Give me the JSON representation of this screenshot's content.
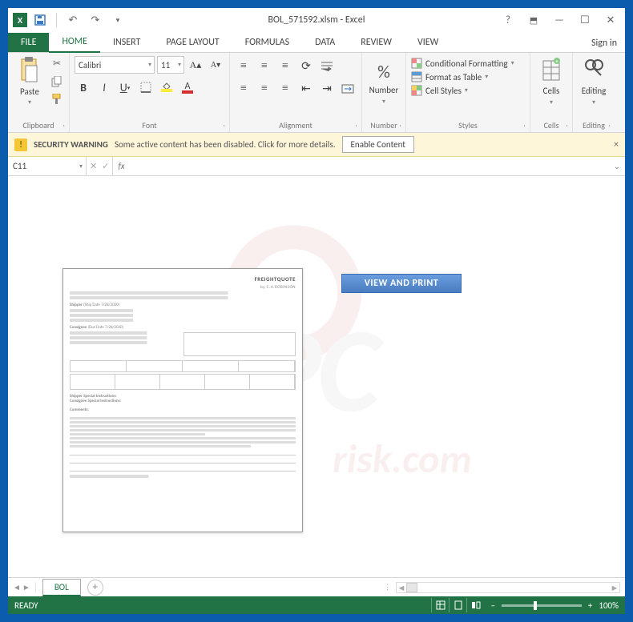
{
  "title": "BOL_571592.xlsm - Excel",
  "tabs": {
    "file": "FILE",
    "home": "HOME",
    "insert": "INSERT",
    "pagelayout": "PAGE LAYOUT",
    "formulas": "FORMULAS",
    "data": "DATA",
    "review": "REVIEW",
    "view": "VIEW"
  },
  "signin": "Sign in",
  "ribbon": {
    "clipboard": {
      "paste": "Paste",
      "label": "Clipboard"
    },
    "font": {
      "name": "Calibri",
      "size": "11",
      "label": "Font"
    },
    "alignment": {
      "label": "Alignment"
    },
    "number": {
      "big": "Number",
      "label": "Number",
      "pct": "%"
    },
    "styles": {
      "cond": "Conditional Formatting",
      "table": "Format as Table",
      "cell": "Cell Styles",
      "label": "Styles"
    },
    "cells": {
      "big": "Cells",
      "label": "Cells"
    },
    "editing": {
      "big": "Editing",
      "label": "Editing"
    }
  },
  "warning": {
    "title": "SECURITY WARNING",
    "text": "Some active content has been disabled. Click for more details.",
    "button": "Enable Content"
  },
  "fx": {
    "cell": "C11",
    "label": "fx"
  },
  "sheet": {
    "button": "VIEW AND PRINT",
    "doc_brand": "FREIGHTQUOTE",
    "doc_sub": "by C.H.ROBINSON"
  },
  "sheettab": "BOL",
  "status": {
    "ready": "READY",
    "zoom": "100%"
  },
  "watermark": {
    "big": "PC",
    "sub": "risk.com"
  }
}
